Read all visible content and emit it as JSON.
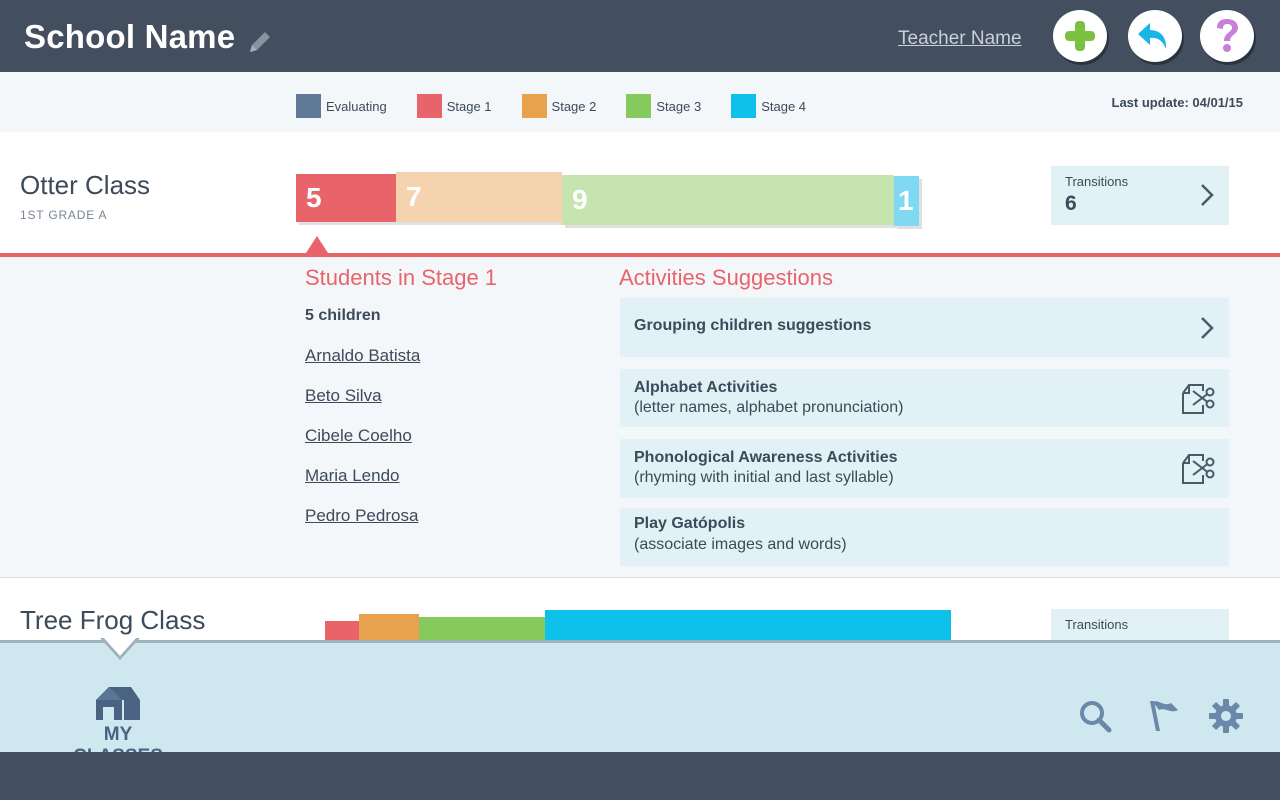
{
  "header": {
    "school_name": "School Name",
    "teacher_name": "Teacher Name",
    "edit_icon": "pencil-icon",
    "buttons": [
      {
        "name": "add-button",
        "icon": "plus-icon",
        "color": "#7ac142"
      },
      {
        "name": "back-button",
        "icon": "undo-arrow-icon",
        "color": "#1ab4e6"
      },
      {
        "name": "help-button",
        "icon": "question-mark-icon",
        "color": "#c77fd8"
      }
    ]
  },
  "legend": {
    "items": [
      {
        "label": "Evaluating",
        "color": "#5f7896"
      },
      {
        "label": "Stage 1",
        "color": "#e8646a"
      },
      {
        "label": "Stage 2",
        "color": "#e8a24e"
      },
      {
        "label": "Stage 3",
        "color": "#86c95c"
      },
      {
        "label": "Stage 4",
        "color": "#0ec1ea"
      }
    ],
    "last_update": "Last update: 04/01/15"
  },
  "otter_class": {
    "name": "Otter Class",
    "grade": "1ST GRADE A",
    "stages": [
      {
        "stage": "Stage 1",
        "count": "5"
      },
      {
        "stage": "Stage 2",
        "count": "7"
      },
      {
        "stage": "Stage 3",
        "count": "9"
      },
      {
        "stage": "Stage 4",
        "count": "1"
      }
    ],
    "transitions_label": "Transitions",
    "transitions_value": "6"
  },
  "stage_panel": {
    "title": "Students in Stage 1",
    "count": "5 children",
    "students": [
      "Arnaldo Batista",
      "Beto Silva",
      "Cibele Coelho",
      "Maria Lendo",
      "Pedro Pedrosa"
    ]
  },
  "activities": {
    "title": "Activities Suggestions",
    "items": [
      {
        "title": "Grouping children suggestions",
        "subtitle": "",
        "icon": "chevron-right-icon"
      },
      {
        "title": "Alphabet Activities",
        "subtitle": "(letter names, alphabet pronunciation)",
        "icon": "cut-print-icon"
      },
      {
        "title": "Phonological Awareness Activities",
        "subtitle": "(rhyming with initial and last syllable)",
        "icon": "cut-print-icon"
      },
      {
        "title": "Play Gatópolis",
        "subtitle": "(associate images and words)",
        "icon": ""
      }
    ]
  },
  "tree_frog_class": {
    "name": "Tree Frog Class",
    "transitions_label": "Transitions"
  },
  "bottom_nav": {
    "my_classes": "MY CLASSES",
    "icons": [
      "search-icon",
      "flag-icon",
      "gear-icon"
    ]
  }
}
